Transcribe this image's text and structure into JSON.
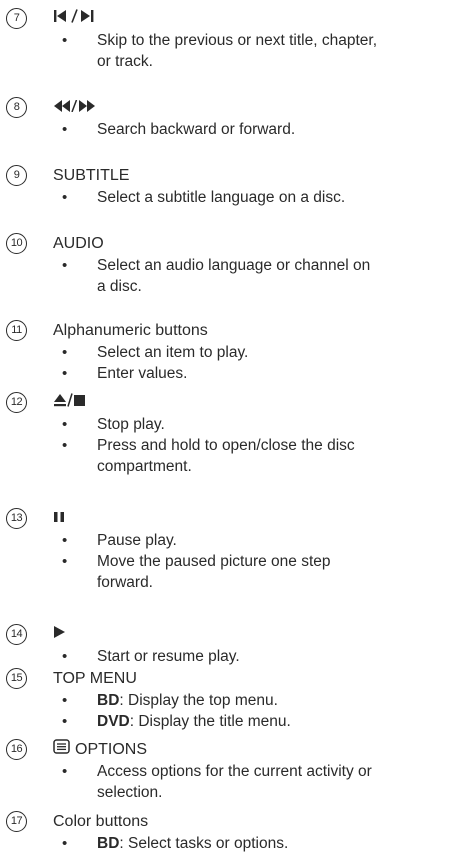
{
  "entries": [
    {
      "num": "7",
      "title": "",
      "icon": "skip-prev-next-icon",
      "lines": [
        {
          "bullet": true,
          "text": "Skip to the previous or next title, chapter,"
        },
        {
          "bullet": false,
          "text": "or track."
        }
      ]
    },
    {
      "num": "8",
      "title": "",
      "icon": "search-backward-forward-icon",
      "lines": [
        {
          "bullet": true,
          "text": "Search backward or forward."
        }
      ]
    },
    {
      "num": "9",
      "title": "SUBTITLE",
      "lines": [
        {
          "bullet": true,
          "text": "Select a subtitle language on a disc."
        }
      ]
    },
    {
      "num": "10",
      "title": "AUDIO",
      "lines": [
        {
          "bullet": true,
          "text": "Select an audio language or channel on"
        },
        {
          "bullet": false,
          "text": "a disc."
        }
      ]
    },
    {
      "num": "11",
      "title": "Alphanumeric buttons",
      "lines": [
        {
          "bullet": true,
          "text": "Select an item to play."
        },
        {
          "bullet": true,
          "text": "Enter values."
        }
      ]
    },
    {
      "num": "12",
      "title": "",
      "icon": "eject-stop-icon",
      "lines": [
        {
          "bullet": true,
          "text": "Stop play."
        },
        {
          "bullet": true,
          "text": "Press and hold to open/close the disc"
        },
        {
          "bullet": false,
          "text": "compartment."
        }
      ]
    },
    {
      "num": "13",
      "title": "",
      "icon": "pause-icon",
      "lines": [
        {
          "bullet": true,
          "text": "Pause play."
        },
        {
          "bullet": true,
          "text": "Move the paused picture one step"
        },
        {
          "bullet": false,
          "text": "forward."
        }
      ]
    },
    {
      "num": "14",
      "title": "",
      "icon": "play-icon",
      "lines": [
        {
          "bullet": true,
          "text": "Start or resume play."
        }
      ]
    },
    {
      "num": "15",
      "title": "TOP MENU",
      "lines": [
        {
          "bullet": true,
          "bold": "BD",
          "text": ": Display the top menu."
        },
        {
          "bullet": true,
          "bold": "DVD",
          "text": ": Display the title menu."
        }
      ]
    },
    {
      "num": "16",
      "title": "OPTIONS",
      "icon": "options-icon",
      "lines": [
        {
          "bullet": true,
          "text": "Access options for the current activity or"
        },
        {
          "bullet": false,
          "text": "selection."
        }
      ]
    },
    {
      "num": "17",
      "title": "Color buttons",
      "lines": [
        {
          "bullet": true,
          "bold": "BD",
          "text": ": Select tasks or options."
        }
      ]
    }
  ],
  "bullet_char": "•"
}
